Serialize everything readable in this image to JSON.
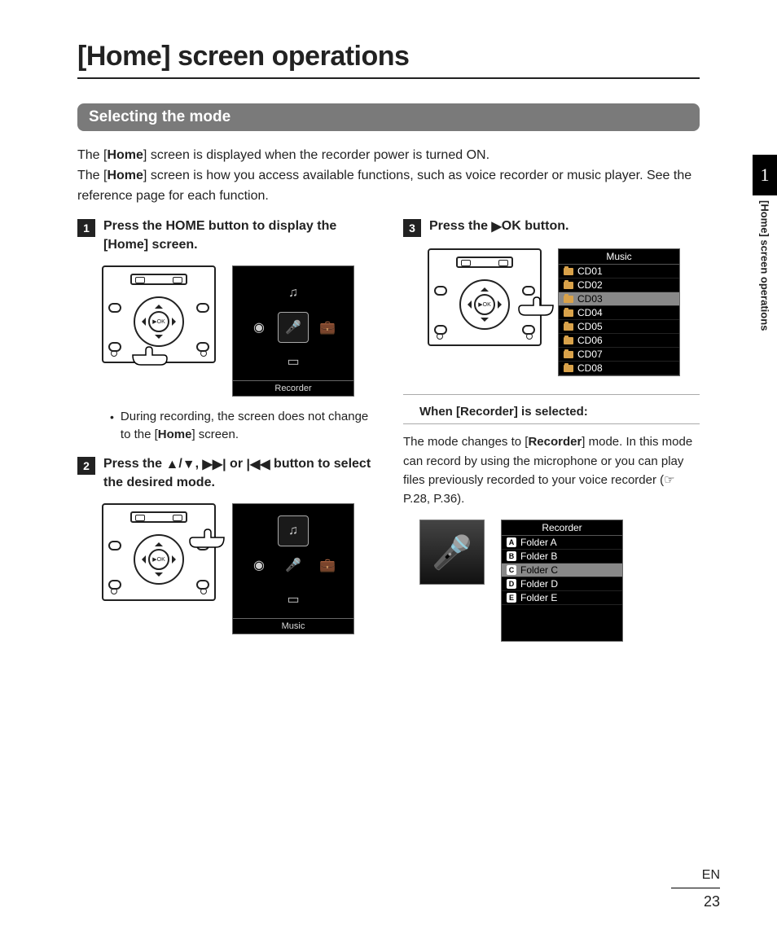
{
  "title_bracket_open": "[",
  "title_bold": "Home",
  "title_rest": "] screen operations",
  "section_bar": "Selecting the mode",
  "intro_line1_a": "The [",
  "intro_line1_b": "Home",
  "intro_line1_c": "] screen is displayed when the recorder power is turned ON.",
  "intro_line2_a": "The [",
  "intro_line2_b": "Home",
  "intro_line2_c": "] screen is how you access available functions, such as voice recorder or music player. See the reference page for each function.",
  "step1": {
    "num": "1",
    "pre": "Press the ",
    "bold1": "HOME",
    "mid1": " button to display the [",
    "bold2": "Home",
    "post": "] screen."
  },
  "screen1_footer": "Recorder",
  "bullet_a": "During recording, the screen does not change to the [",
  "bullet_b": "Home",
  "bullet_c": "] screen.",
  "step2": {
    "num": "2",
    "pre": "Press the ",
    "post": " button to select the desired mode."
  },
  "screen2_footer": "Music",
  "step3": {
    "num": "3",
    "pre": "Press the ",
    "bold1": "OK",
    "post": " button."
  },
  "music_list": {
    "title": "Music",
    "items": [
      "CD01",
      "CD02",
      "CD03",
      "CD04",
      "CD05",
      "CD06",
      "CD07",
      "CD08"
    ],
    "selected_index": 2
  },
  "sub_when_a": "When [",
  "sub_when_b": "Recorder",
  "sub_when_c": "] is selected:",
  "recorder_para_a": "The mode changes to [",
  "recorder_para_b": "Recorder",
  "recorder_para_c": "] mode. In this mode can record by using the microphone or you can play files previously recorded to your voice recorder (☞ P.28, P.36).",
  "recorder_list": {
    "title": "Recorder",
    "items": [
      {
        "badge": "A",
        "name": "Folder A"
      },
      {
        "badge": "B",
        "name": "Folder B"
      },
      {
        "badge": "C",
        "name": "Folder C"
      },
      {
        "badge": "D",
        "name": "Folder D"
      },
      {
        "badge": "E",
        "name": "Folder E"
      }
    ],
    "selected_index": 2
  },
  "sidebar": {
    "chapter": "1",
    "label": "[Home] screen operations"
  },
  "footer": {
    "lang": "EN",
    "page": "23"
  }
}
